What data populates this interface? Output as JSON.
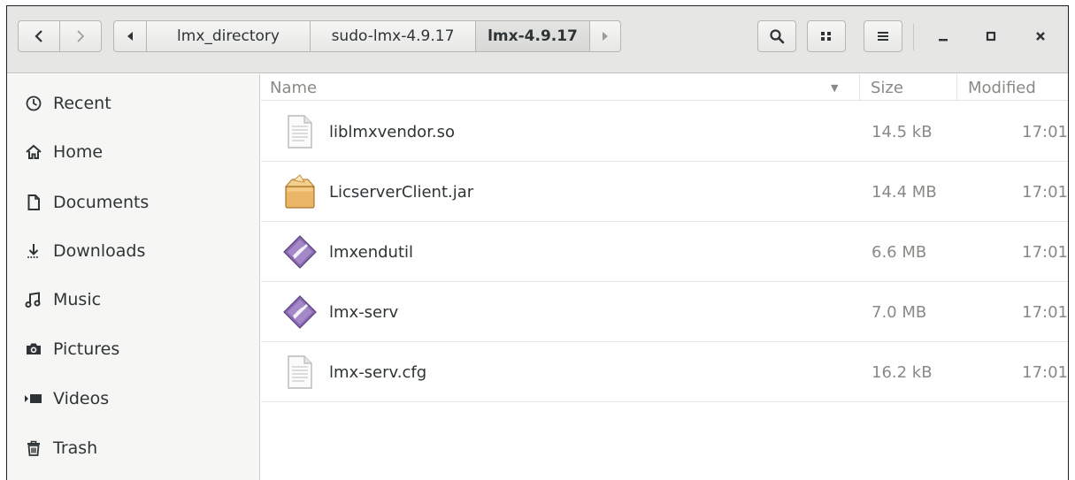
{
  "breadcrumb": {
    "items": [
      "lmx_directory",
      "sudo-lmx-4.9.17",
      "lmx-4.9.17"
    ],
    "current_index": 2
  },
  "toolbar": {
    "search_icon": "search-icon",
    "view_icon": "grid-view-icon",
    "menu_icon": "hamburger-menu-icon"
  },
  "sidebar": {
    "items": [
      {
        "label": "Recent",
        "icon": "clock-icon"
      },
      {
        "label": "Home",
        "icon": "home-icon"
      },
      {
        "label": "Documents",
        "icon": "document-icon"
      },
      {
        "label": "Downloads",
        "icon": "download-icon"
      },
      {
        "label": "Music",
        "icon": "music-icon"
      },
      {
        "label": "Pictures",
        "icon": "camera-icon"
      },
      {
        "label": "Videos",
        "icon": "video-icon"
      },
      {
        "label": "Trash",
        "icon": "trash-icon"
      }
    ]
  },
  "columns": {
    "name": "Name",
    "size": "Size",
    "modified": "Modified"
  },
  "files": [
    {
      "name": "liblmxvendor.so",
      "size": "14.5 kB",
      "modified": "17:01",
      "icon": "text-file-icon"
    },
    {
      "name": "LicserverClient.jar",
      "size": "14.4 MB",
      "modified": "17:01",
      "icon": "archive-package-icon"
    },
    {
      "name": "lmxendutil",
      "size": "6.6 MB",
      "modified": "17:01",
      "icon": "executable-icon"
    },
    {
      "name": "lmx-serv",
      "size": "7.0 MB",
      "modified": "17:01",
      "icon": "executable-icon"
    },
    {
      "name": "lmx-serv.cfg",
      "size": "16.2 kB",
      "modified": "17:01",
      "icon": "text-file-icon"
    }
  ],
  "colors": {
    "headerbar": "#e6e6e4",
    "sidebar": "#f6f6f5",
    "text": "#2e3436",
    "muted": "#888a85"
  }
}
